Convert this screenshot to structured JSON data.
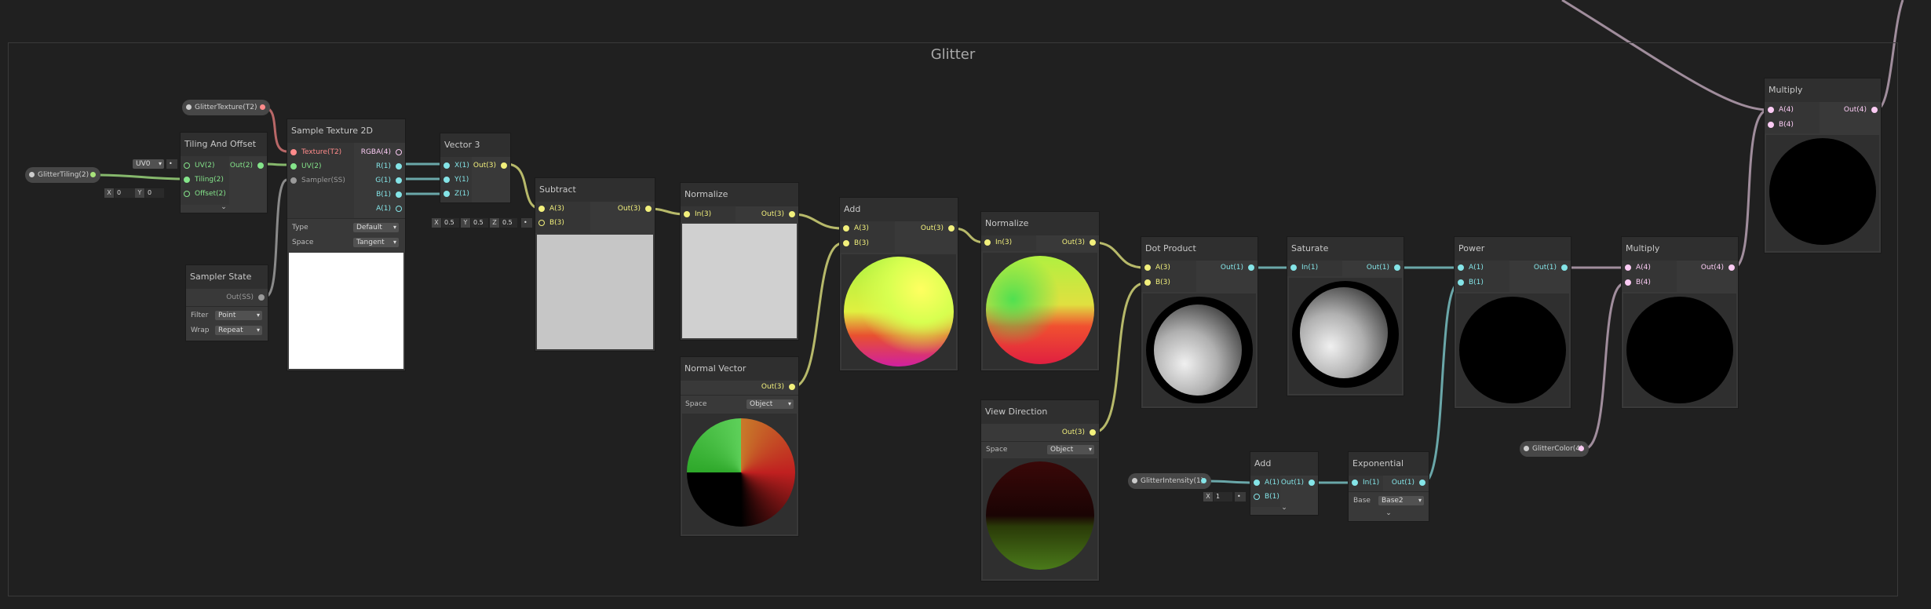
{
  "group": {
    "title": "Glitter"
  },
  "properties": {
    "glitter_texture": "GlitterTexture(T2)",
    "glitter_tiling": "GlitterTiling(2)",
    "glitter_intensity": "GlitterIntensity(1)",
    "glitter_color": "GlitterColor(4)"
  },
  "nodes": {
    "tiling_offset": {
      "title": "Tiling And Offset",
      "in": [
        "UV(2)",
        "Tiling(2)",
        "Offset(2)"
      ],
      "out": [
        "Out(2)"
      ],
      "uv_dropdown": "UV0",
      "offset_x_label": "X",
      "offset_x": "0",
      "offset_y_label": "Y",
      "offset_y": "0"
    },
    "sample_texture": {
      "title": "Sample Texture 2D",
      "in": [
        "Texture(T2)",
        "UV(2)",
        "Sampler(SS)"
      ],
      "out": [
        "RGBA(4)",
        "R(1)",
        "G(1)",
        "B(1)",
        "A(1)"
      ],
      "type_label": "Type",
      "type_value": "Default",
      "space_label": "Space",
      "space_value": "Tangent"
    },
    "sampler_state": {
      "title": "Sampler State",
      "out": [
        "Out(SS)"
      ],
      "filter_label": "Filter",
      "filter_value": "Point",
      "wrap_label": "Wrap",
      "wrap_value": "Repeat"
    },
    "vector3": {
      "title": "Vector 3",
      "in": [
        "X(1)",
        "Y(1)",
        "Z(1)"
      ],
      "out": [
        "Out(3)"
      ],
      "x_label": "X",
      "x": "0.5",
      "y_label": "Y",
      "y": "0.5",
      "z_label": "Z",
      "z": "0.5"
    },
    "subtract": {
      "title": "Subtract",
      "in": [
        "A(3)",
        "B(3)"
      ],
      "out": [
        "Out(3)"
      ]
    },
    "normalize1": {
      "title": "Normalize",
      "in": [
        "In(3)"
      ],
      "out": [
        "Out(3)"
      ]
    },
    "normal_vector": {
      "title": "Normal Vector",
      "out": [
        "Out(3)"
      ],
      "space_label": "Space",
      "space_value": "Object"
    },
    "add1": {
      "title": "Add",
      "in": [
        "A(3)",
        "B(3)"
      ],
      "out": [
        "Out(3)"
      ]
    },
    "normalize2": {
      "title": "Normalize",
      "in": [
        "In(3)"
      ],
      "out": [
        "Out(3)"
      ]
    },
    "view_direction": {
      "title": "View Direction",
      "out": [
        "Out(3)"
      ],
      "space_label": "Space",
      "space_value": "Object"
    },
    "dot_product": {
      "title": "Dot Product",
      "in": [
        "A(3)",
        "B(3)"
      ],
      "out": [
        "Out(1)"
      ]
    },
    "saturate": {
      "title": "Saturate",
      "in": [
        "In(1)"
      ],
      "out": [
        "Out(1)"
      ]
    },
    "power": {
      "title": "Power",
      "in": [
        "A(1)",
        "B(1)"
      ],
      "out": [
        "Out(1)"
      ]
    },
    "multiply1": {
      "title": "Multiply",
      "in": [
        "A(4)",
        "B(4)"
      ],
      "out": [
        "Out(4)"
      ]
    },
    "add2": {
      "title": "Add",
      "in": [
        "A(1)",
        "B(1)"
      ],
      "out": [
        "Out(1)"
      ],
      "b_label": "X",
      "b_value": "1"
    },
    "exponential": {
      "title": "Exponential",
      "in": [
        "In(1)"
      ],
      "out": [
        "Out(1)"
      ],
      "base_label": "Base",
      "base_value": "Base2"
    },
    "multiply2": {
      "title": "Multiply",
      "in": [
        "A(4)",
        "B(4)"
      ],
      "out": [
        "Out(4)"
      ]
    }
  },
  "colors": {
    "background": "#202020",
    "node": "#393939",
    "wire_vec3": "#b7b96a",
    "wire_float": "#6aa7a9",
    "wire_vec2": "#86b86c",
    "wire_vec4": "#a08d9c",
    "wire_tex": "#c56a6a"
  }
}
